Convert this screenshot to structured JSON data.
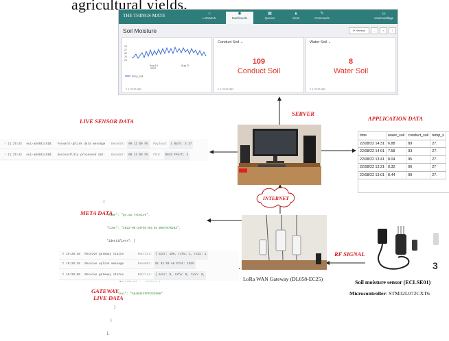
{
  "top_text": "agricultural yields.",
  "dashboard": {
    "brand": "THE THINGS MATE",
    "nav": [
      {
        "label": "LoRaWAN",
        "icon": "⌂",
        "active": false
      },
      {
        "label": "Dashboards",
        "icon": "◉",
        "active": true
      },
      {
        "label": "Queries",
        "icon": "▦",
        "active": false
      },
      {
        "label": "Alerts",
        "icon": "▲",
        "active": false
      },
      {
        "label": "Commands",
        "icon": "✎",
        "active": false
      }
    ],
    "user": "commonvillage",
    "title": "Soil Moisture",
    "refresh": "⟳ Refresh",
    "cards": [
      {
        "title": "",
        "legend": "temp_soil",
        "date1": "Aug 14",
        "year": "2022",
        "date2": "Aug 21",
        "yticks": [
          "28",
          "27",
          "26",
          "25",
          "24"
        ],
        "ago": "0 4 hours ago"
      },
      {
        "title": "Conduct Soil ⌄",
        "value": "109",
        "label": "Conduct Soil",
        "ago": "0 4 hours ago"
      },
      {
        "title": "Water Soil ⌄",
        "value": "8",
        "label": "Water Soil",
        "ago": "0 4 hours ago"
      }
    ]
  },
  "labels": {
    "live": "LIVE SENSOR DATA",
    "server": "SERVER",
    "application": "APPLICATION DATA",
    "meta": "META DATA",
    "internet": "INTERNET",
    "rf": "RF SIGNAL",
    "gateway": "GATEWAY",
    "gateway2": "LIVE DATA"
  },
  "live_log": [
    {
      "time": "↑ 11:25:43",
      "dev": "eui-a8404ic51B.",
      "msg": "Forward uplink data message",
      "k1": "DevAddr:",
      "v1": "00 13 D0 F5",
      "k2": "Payload:",
      "v2": "{ BatV: 3.37"
    },
    {
      "time": "↑ 11:25:43",
      "dev": "eui-a8404ic51B.",
      "msg": "Successfully processed dat.",
      "k1": "DevAddr:",
      "v1": "00 13 D0 F5",
      "k2": "FCnt:",
      "v2": "9919  FPort: 2"
    }
  ],
  "app_table": {
    "headers": [
      "time",
      "water_soil",
      "conduct_soil",
      "temp_s"
    ],
    "rows": [
      [
        "22/08/22 14:31",
        "6.88",
        "89",
        "27."
      ],
      [
        "22/08/22 14:01",
        "7.58",
        "93",
        "27."
      ],
      [
        "22/08/22 13:41",
        "8.04",
        "95",
        "27."
      ],
      [
        "22/08/22 13:21",
        "8.32",
        "96",
        "27"
      ],
      [
        "22/08/22 13:01",
        "8.44",
        "99",
        "27."
      ]
    ]
  },
  "meta_json": [
    "{",
    "  \"name\": \"gs.up.receive\",",
    "  \"time\": \"2022-08-24T04:04:36.066T07028Z\",",
    "  \"identifiers\": [",
    "    {",
    "      \"gateway_ids\": {",
    "        \"gateway_id\": \"eic1001\",",
    "        \"eui\": \"A84041FFFF232968\"",
    "      }",
    "    }",
    "  ],"
  ],
  "gateway_log": [
    {
      "time": "⇪ 10:20:38",
      "msg": "Receive gateway status",
      "k": "Metrics:",
      "v": "{ ackr: 100, rxfw: 1, rxin: 1"
    },
    {
      "time": "⇪ 10:20:38",
      "msg": "Receive uplink message",
      "k": "DevAddr:",
      "v": "01 33 03 A8   FCnt: 1029"
    },
    {
      "time": "⇪ 10:20:08",
      "msg": "Receive gateway status",
      "k": "Metrics:",
      "v": "{ ackr: 0, rxfw: 0, rxin: 0,"
    }
  ],
  "captions": {
    "gateway": "LoRa WAN Gateway (DL058-EC25)",
    "sensor": "Soil moisture sensor  (ECLSE01)",
    "mcu_label": "Microcontroller",
    "mcu": ": STM32L072CXT6",
    "page_num": "3"
  },
  "colors": {
    "accent": "#2e7d7a",
    "red": "#d71920",
    "value_red": "#e2352b"
  }
}
